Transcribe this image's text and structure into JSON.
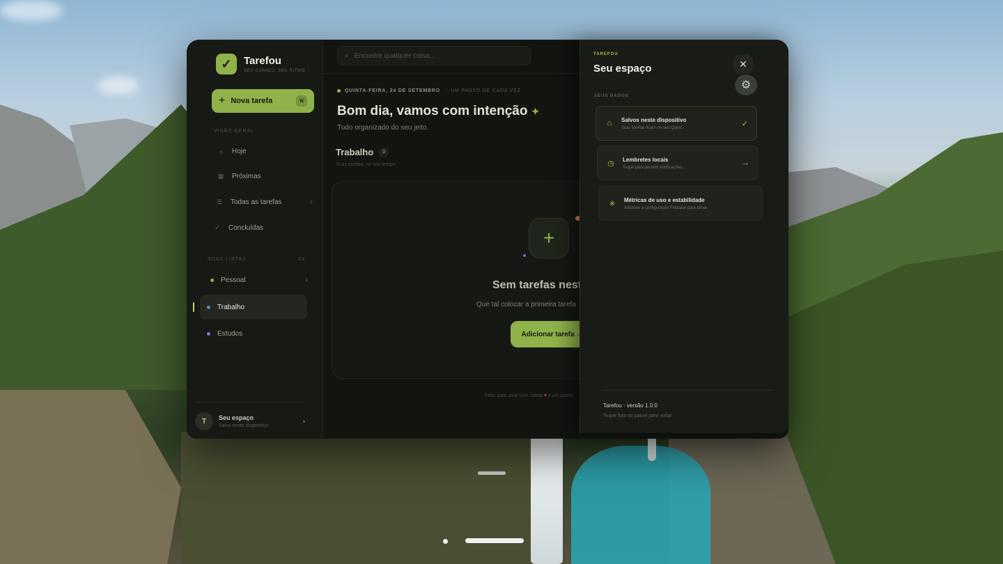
{
  "sidebar": {
    "brand_name": "Tarefou",
    "brand_tagline": "Seu espaço, seu ritmo",
    "new_task_label": "Nova tarefa",
    "new_task_shortcut": "N",
    "overview_label": "Visão geral",
    "nav": [
      {
        "label": "Hoje",
        "icon": "sun-icon",
        "count": ""
      },
      {
        "label": "Próximas",
        "icon": "calendar-icon",
        "count": ""
      },
      {
        "label": "Todas as tarefas",
        "icon": "list-icon",
        "count": "1"
      },
      {
        "label": "Concluídas",
        "icon": "check-icon",
        "count": ""
      }
    ],
    "lists_label": "Suas listas",
    "lists_count": "03",
    "lists": [
      {
        "label": "Pessoal",
        "color": "#8fb24a",
        "count": "1"
      },
      {
        "label": "Trabalho",
        "color": "#5f86c9",
        "count": ""
      },
      {
        "label": "Estudos",
        "color": "#8a6fd1",
        "count": ""
      }
    ],
    "user": {
      "initial": "T",
      "name": "Seu espaço",
      "status": "Salvo neste dispositivo"
    }
  },
  "main": {
    "search_placeholder": "Encontre qualquer coisa...",
    "date": "Quinta-feira, 24 de setembro",
    "date_sep": "·",
    "date_motto": "Um passo de cada vez",
    "greeting": "Bom dia, vamos com intenção",
    "greeting_sub": "Tudo organizado do seu jeito.",
    "list_title": "Trabalho",
    "list_count": "0",
    "list_sub": "Suas tarefas, no seu tempo.",
    "empty_title": "Sem tarefas nesta",
    "empty_sub": "Que tal colocar a primeira tarefa",
    "add_task_label": "Adicionar tarefa →",
    "footer_before": "Feito para usar com calma",
    "footer_after": "e um passo"
  },
  "panel": {
    "brand": "Tarefou",
    "title": "Seu espaço",
    "section": "Seus dados",
    "options": [
      {
        "title": "Salvos neste dispositivo",
        "sub": "Suas tarefas ficam no seu Quest.",
        "icon": "home-icon",
        "right": "✓"
      },
      {
        "title": "Lembretes locais",
        "sub": "Toque para permitir notificações.",
        "icon": "clock-icon",
        "right": "→"
      },
      {
        "title": "Métricas de uso e estabilidade",
        "sub": "Adicione a configuração Firebase para ativar.",
        "icon": "sparkle-icon",
        "right": ""
      }
    ],
    "version": "Tarefou · versão 1.0.0",
    "version_sub": "Toque fora do painel para voltar."
  },
  "colors": {
    "accent": "#8fb24a",
    "panel_bg": "#181b16",
    "app_bg": "#121410"
  }
}
